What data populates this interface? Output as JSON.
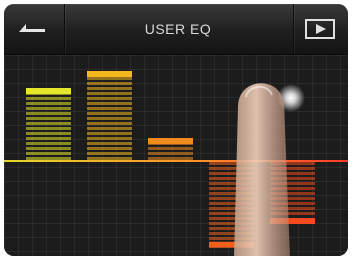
{
  "header": {
    "title": "USER EQ",
    "back_icon": "back-arrow-icon",
    "play_icon": "play-box-icon"
  },
  "eq": {
    "bands": [
      {
        "value": 0.7,
        "color": "#e6e62a"
      },
      {
        "value": 0.87,
        "color": "#f2b81c"
      },
      {
        "value": 0.2,
        "color": "#f28a1c"
      },
      {
        "value": -0.85,
        "color": "#f2601c"
      },
      {
        "value": -0.6,
        "color": "#f24a1c"
      }
    ],
    "zero_line_color_left": "#e6d82a",
    "zero_line_color_right": "#ff3a2a"
  }
}
